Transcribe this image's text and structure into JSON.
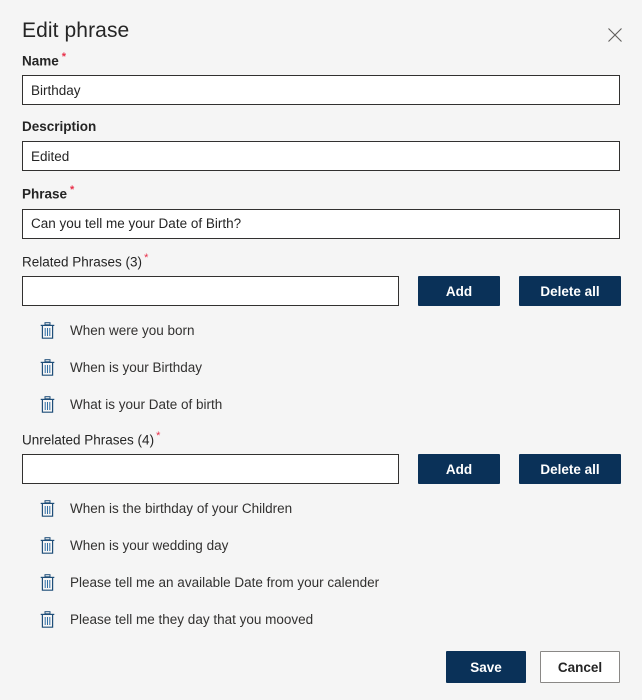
{
  "dialog": {
    "title": "Edit phrase",
    "close_icon": "close-icon",
    "accent_color": "#0a3158",
    "required_marker": "*",
    "required_color": "#e8304a",
    "background_color": "#f5f5f5"
  },
  "fields": {
    "name": {
      "label": "Name",
      "required": true,
      "value": "Birthday",
      "placeholder": ""
    },
    "description": {
      "label": "Description",
      "required": false,
      "value": "Edited",
      "placeholder": ""
    },
    "phrase": {
      "label": "Phrase",
      "required": true,
      "value": "Can you tell me your Date of Birth?",
      "placeholder": ""
    }
  },
  "related_phrases": {
    "label": "Related Phrases (3)",
    "count": 3,
    "required": true,
    "input_value": "",
    "input_placeholder": "",
    "add_label": "Add",
    "delete_all_label": "Delete all",
    "items": [
      {
        "text": "When were you born",
        "delete_icon": "trash-icon"
      },
      {
        "text": "When is your Birthday",
        "delete_icon": "trash-icon"
      },
      {
        "text": "What is your Date of birth",
        "delete_icon": "trash-icon"
      }
    ]
  },
  "unrelated_phrases": {
    "label": "Unrelated Phrases (4)",
    "count": 4,
    "required": true,
    "input_value": "",
    "input_placeholder": "",
    "add_label": "Add",
    "delete_all_label": "Delete all",
    "items": [
      {
        "text": "When is the birthday of your Children",
        "delete_icon": "trash-icon"
      },
      {
        "text": "When is your wedding day",
        "delete_icon": "trash-icon"
      },
      {
        "text": "Please tell me an available Date from your calender",
        "delete_icon": "trash-icon"
      },
      {
        "text": "Please tell me they day that you mooved",
        "delete_icon": "trash-icon"
      }
    ]
  },
  "footer": {
    "save_label": "Save",
    "cancel_label": "Cancel"
  }
}
